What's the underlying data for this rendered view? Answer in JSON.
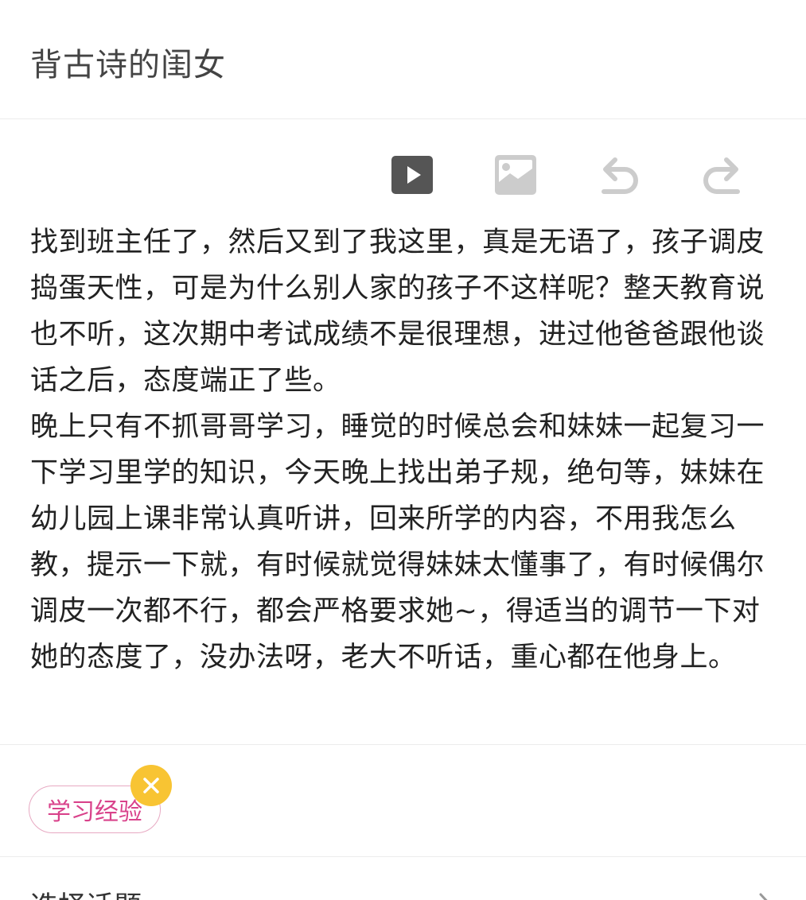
{
  "header": {
    "title": "背古诗的闺女"
  },
  "toolbar": {
    "items": [
      {
        "icon": "video-icon",
        "enabled": true
      },
      {
        "icon": "image-icon",
        "enabled": false
      },
      {
        "icon": "undo-icon",
        "enabled": false
      },
      {
        "icon": "redo-icon",
        "enabled": false
      }
    ]
  },
  "editor": {
    "paragraphs": [
      "找到班主任了，然后又到了我这里，真是无语了，孩子调皮捣蛋天性，可是为什么别人家的孩子不这样呢？整天教育说也不听，这次期中考试成绩不是很理想，进过他爸爸跟他谈话之后，态度端正了些。",
      "晚上只有不抓哥哥学习，睡觉的时候总会和妹妹一起复习一下学习里学的知识，今天晚上找出弟子规，绝句等，妹妹在幼儿园上课非常认真听讲，回来所学的内容，不用我怎么教，提示一下就，有时候就觉得妹妹太懂事了，有时候偶尔调皮一次都不行，都会严格要求她~，得适当的调节一下对她的态度了，没办法呀，老大不听话，重心都在他身上。"
    ]
  },
  "tags": {
    "items": [
      {
        "label": "学习经验"
      }
    ]
  },
  "topic": {
    "label": "选择话题"
  },
  "colors": {
    "accent_pink": "#d9438b",
    "tag_border": "#e7a9c2",
    "remove_badge": "#f8c433",
    "icon_active": "#555555",
    "icon_disabled": "#cccccc"
  }
}
